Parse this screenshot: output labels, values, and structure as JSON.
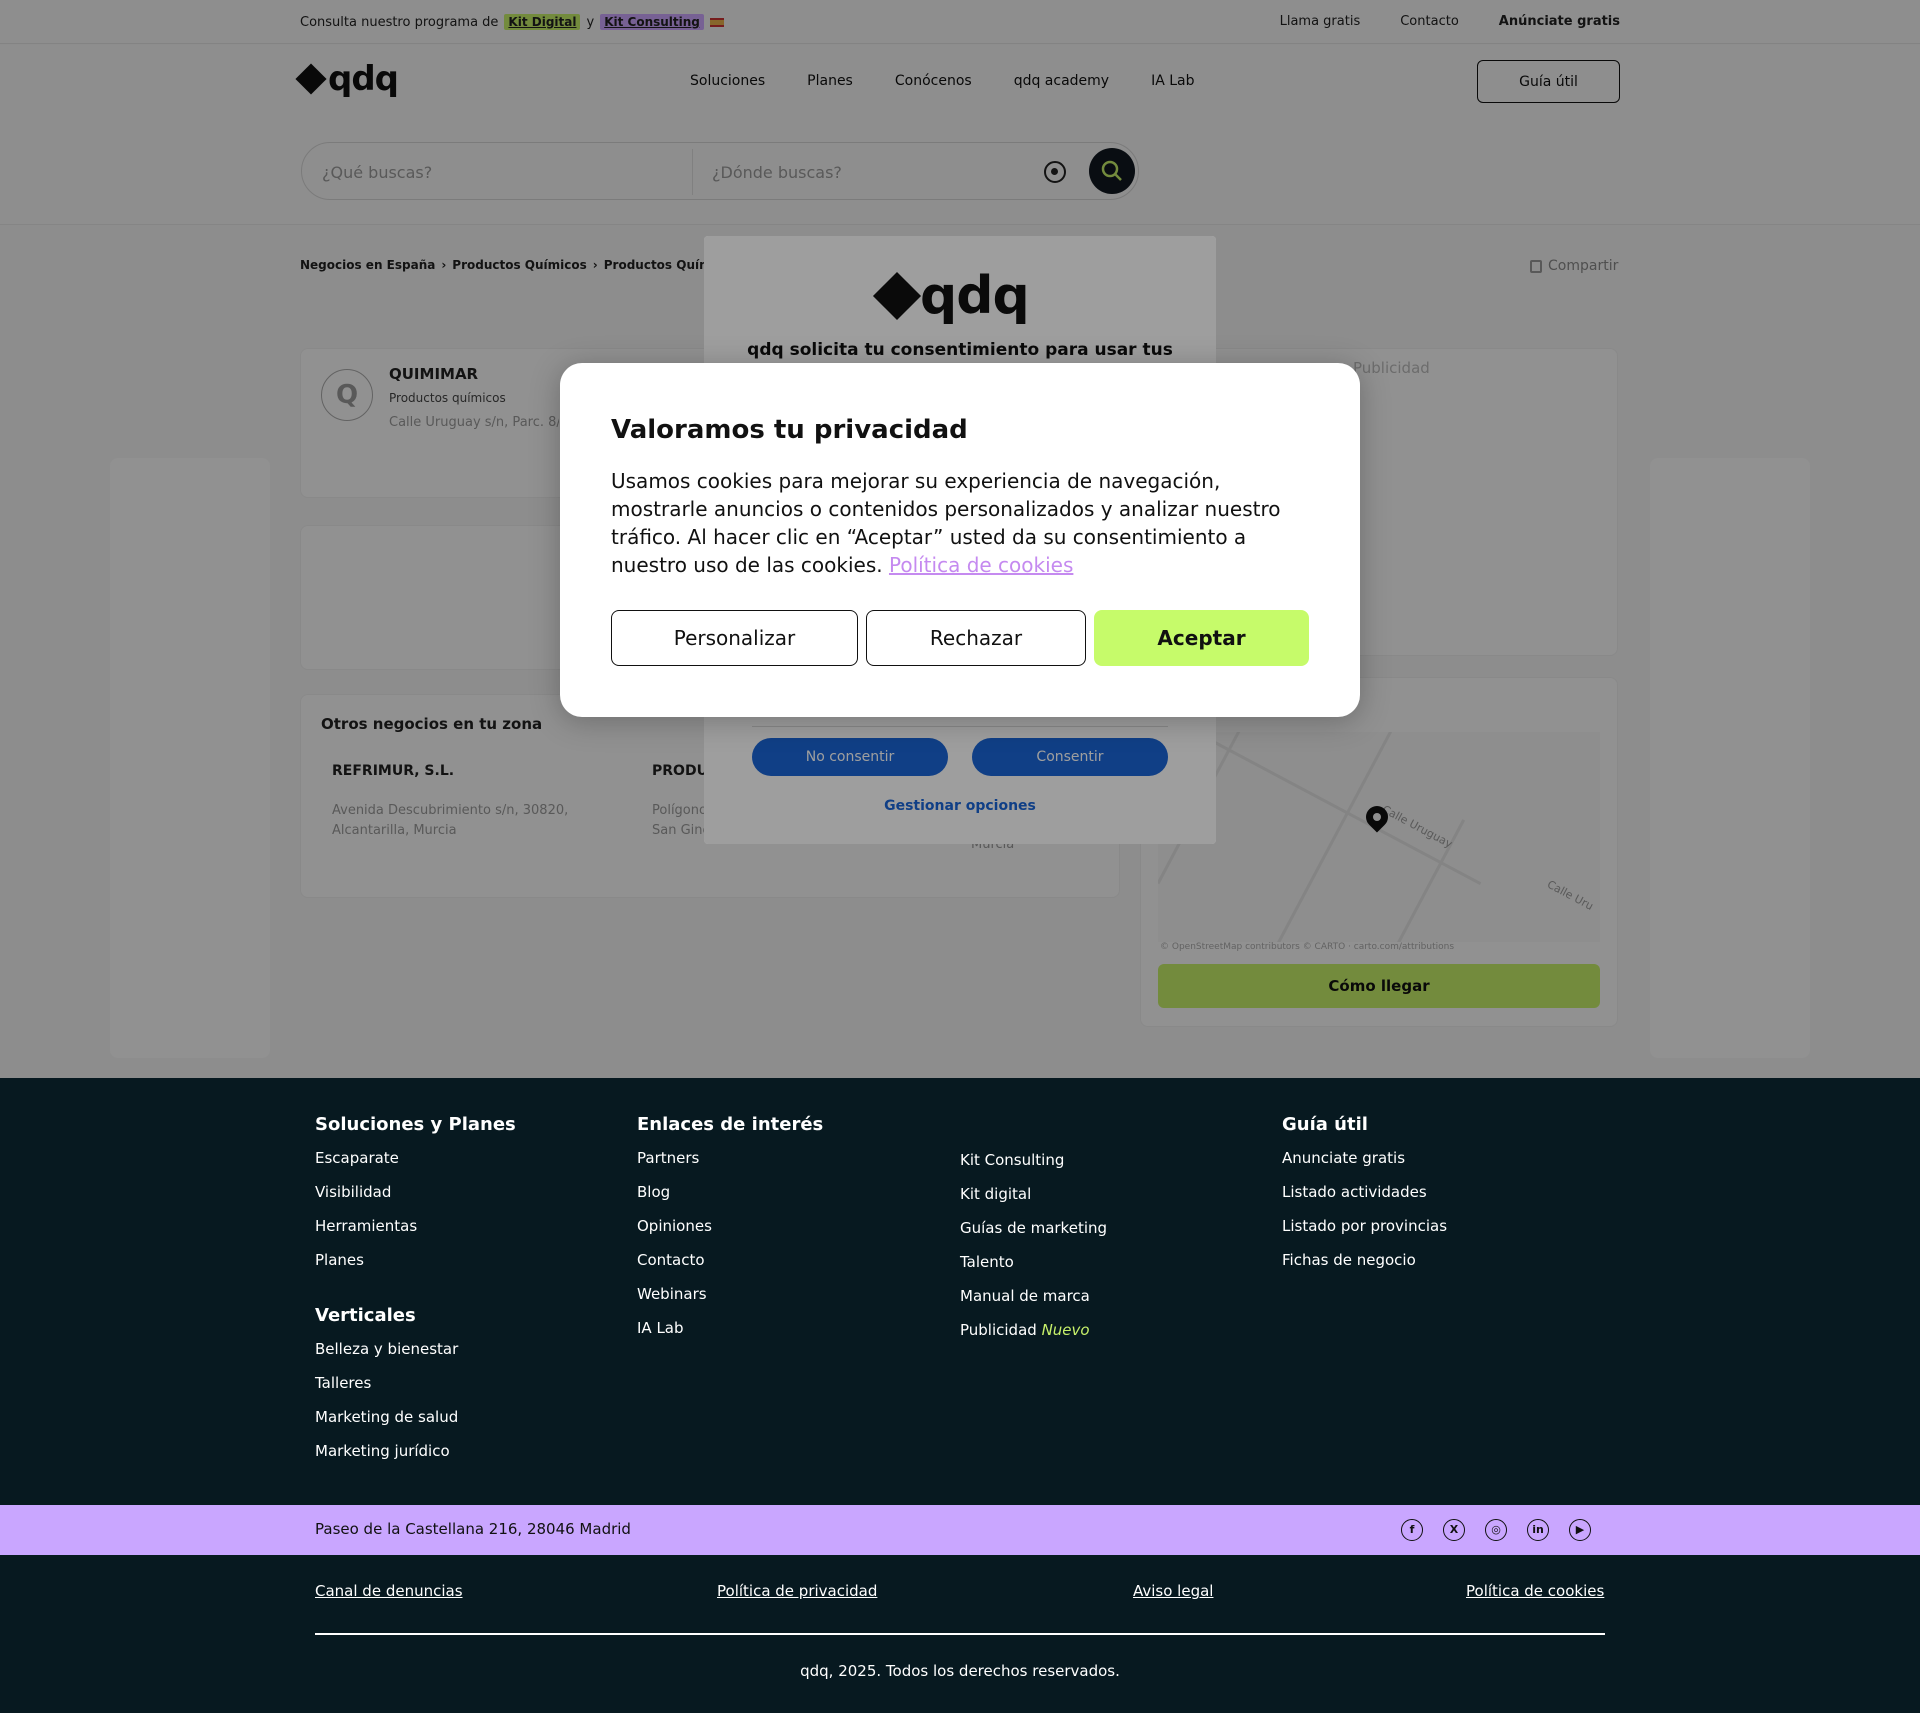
{
  "topbar": {
    "promo_text": "Consulta nuestro programa de",
    "kit_digital": "Kit Digital",
    "and": "y",
    "kit_consulting": "Kit Consulting",
    "links": [
      "Llama gratis",
      "Contacto",
      "Anúnciate gratis"
    ]
  },
  "header": {
    "logo": "qdq",
    "nav": [
      "Soluciones",
      "Planes",
      "Conócenos",
      "qdq academy",
      "IA Lab"
    ],
    "guia_button": "Guía útil",
    "search": {
      "what_placeholder": "¿Qué buscas?",
      "where_placeholder": "¿Dónde buscas?"
    }
  },
  "breadcrumb": [
    "Negocios en España",
    "Productos Químicos",
    "Productos Químicos en"
  ],
  "share_label": "Compartir",
  "business": {
    "initial": "Q",
    "name": "QUIMIMAR",
    "category": "Productos químicos",
    "address": "Calle Uruguay s/n, Parc. 8/2"
  },
  "publicidad_label": "Publicidad",
  "otros": {
    "title": "Otros negocios en tu zona",
    "items": [
      {
        "name": "REFRIMUR, S.L.",
        "address_1": "Avenida Descubrimiento s/n, 30820,",
        "address_2": "Alcantarilla, Murcia"
      },
      {
        "name": "PRODU",
        "address_1": "Polígono",
        "address_2": "San Ginés"
      }
    ],
    "extra_text": "Murcia"
  },
  "map": {
    "streets": [
      "Calle Uruguay",
      "Calle Uru"
    ],
    "attribution": "© OpenStreetMap contributors © CARTO · carto.com/attributions",
    "directions_button": "Cómo llegar"
  },
  "consent_frame": {
    "logo": "qdq",
    "title": "qdq solicita tu consentimiento para usar tus",
    "no_consent": "No consentir",
    "consent": "Consentir",
    "manage": "Gestionar opciones"
  },
  "cookie_modal": {
    "title": "Valoramos tu privacidad",
    "body": "Usamos cookies para mejorar su experiencia de navegación, mostrarle anuncios o contenidos personalizados y analizar nuestro tráfico. Al hacer clic en “Aceptar” usted da su consentimiento a nuestro uso de las cookies.",
    "policy_link": "Política de cookies",
    "personalize": "Personalizar",
    "reject": "Rechazar",
    "accept": "Aceptar"
  },
  "footer": {
    "col1": {
      "title": "Soluciones y Planes",
      "links": [
        "Escaparate",
        "Visibilidad",
        "Herramientas",
        "Planes"
      ],
      "title2": "Verticales",
      "links2": [
        "Belleza y bienestar",
        "Talleres",
        "Marketing de salud",
        "Marketing jurídico"
      ]
    },
    "col2": {
      "title": "Enlaces de interés",
      "links": [
        "Partners",
        "Blog",
        "Opiniones",
        "Contacto",
        "Webinars",
        "IA Lab"
      ]
    },
    "col3": {
      "links": [
        "Kit Consulting",
        "Kit digital",
        "Guías de marketing",
        "Talento",
        "Manual de marca",
        "Publicidad"
      ],
      "new_badge": "Nuevo"
    },
    "col4": {
      "title": "Guía útil",
      "links": [
        "Anunciate gratis",
        "Listado actividades",
        "Listado por provincias",
        "Fichas de negocio"
      ]
    },
    "address": "Paseo de la Castellana 216, 28046 Madrid",
    "social": [
      "facebook-icon",
      "x-icon",
      "instagram-icon",
      "linkedin-icon",
      "youtube-icon"
    ],
    "legal_links": [
      "Canal de denuncias",
      "Política de privacidad",
      "Aviso legal",
      "Política de cookies"
    ],
    "copyright": "qdq, 2025. Todos los derechos reservados."
  },
  "colors": {
    "accent_green": "#c6f06a",
    "accent_purple": "#c9a6ff",
    "footer_bg": "#071920",
    "consent_blue": "#1a66d9"
  }
}
